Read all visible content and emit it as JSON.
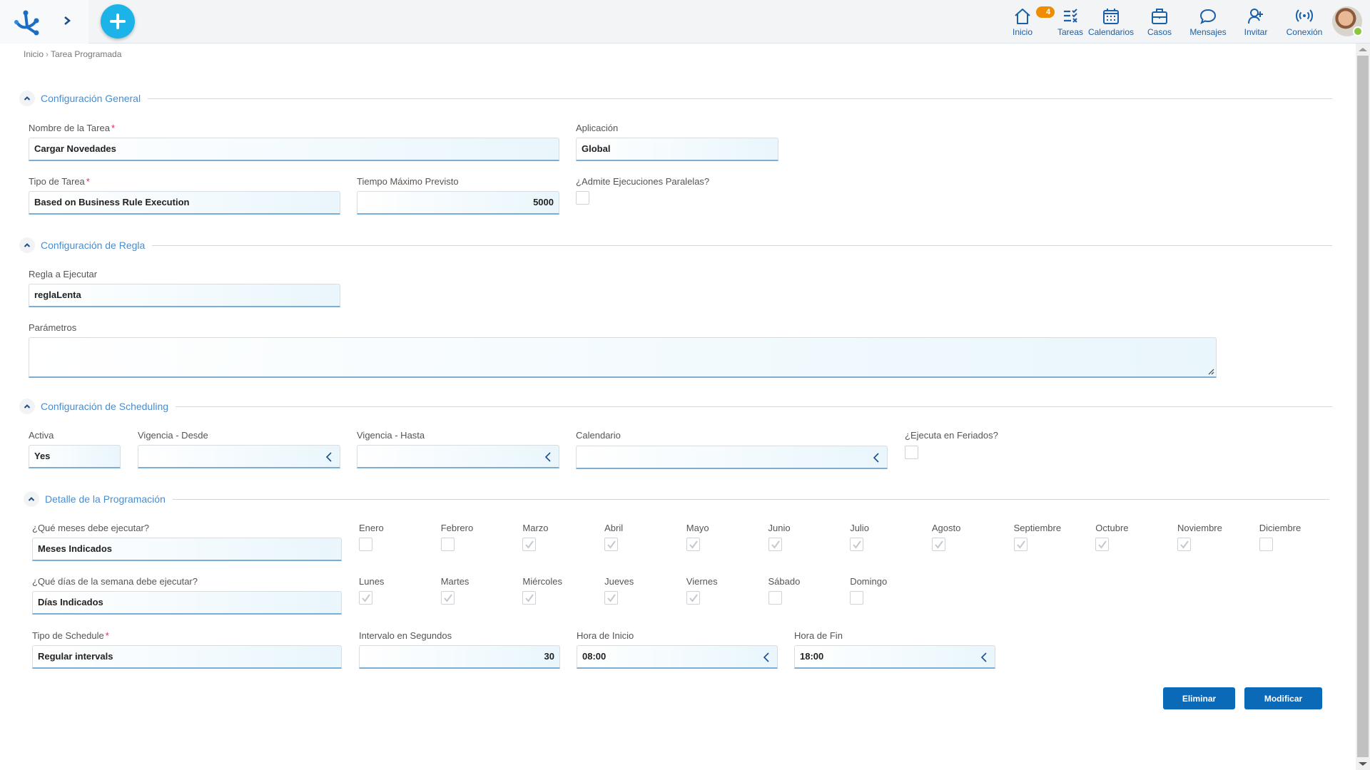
{
  "header": {
    "nav": [
      {
        "id": "inicio",
        "label": "Inicio",
        "icon": "home-icon"
      },
      {
        "id": "tareas",
        "label": "Tareas",
        "icon": "tasks-icon",
        "badge": "4"
      },
      {
        "id": "calendarios",
        "label": "Calendarios",
        "icon": "calendar-icon"
      },
      {
        "id": "casos",
        "label": "Casos",
        "icon": "briefcase-icon"
      },
      {
        "id": "mensajes",
        "label": "Mensajes",
        "icon": "chat-icon"
      },
      {
        "id": "invitar",
        "label": "Invitar",
        "icon": "add-user-icon"
      },
      {
        "id": "conexion",
        "label": "Conexión",
        "icon": "connection-icon"
      }
    ],
    "colors": {
      "accent": "#1bb3e8",
      "nav": "#1a5fa8",
      "badge": "#ef8c00",
      "status": "#8cc63f"
    }
  },
  "breadcrumb": {
    "items": [
      "Inicio",
      "Tarea Programada"
    ],
    "separator": "›"
  },
  "sections": {
    "general": {
      "title": "Configuración General",
      "nombre": {
        "label": "Nombre de la Tarea",
        "required": "*",
        "value": "Cargar Novedades"
      },
      "aplicacion": {
        "label": "Aplicación",
        "value": "Global"
      },
      "tipo": {
        "label": "Tipo de Tarea",
        "required": "*",
        "value": "Based on Business Rule Execution"
      },
      "tiempo": {
        "label": "Tiempo Máximo Previsto",
        "value": "5000"
      },
      "paralelas": {
        "label": "¿Admite Ejecuciones Paralelas?",
        "checked": false
      }
    },
    "regla": {
      "title": "Configuración de Regla",
      "regla": {
        "label": "Regla a Ejecutar",
        "value": "reglaLenta"
      },
      "parametros": {
        "label": "Parámetros",
        "value": ""
      }
    },
    "scheduling": {
      "title": "Configuración de Scheduling",
      "activa": {
        "label": "Activa",
        "value": "Yes"
      },
      "desde": {
        "label": "Vigencia - Desde",
        "value": ""
      },
      "hasta": {
        "label": "Vigencia - Hasta",
        "value": ""
      },
      "calendario": {
        "label": "Calendario",
        "value": ""
      },
      "feriados": {
        "label": "¿Ejecuta en Feriados?",
        "checked": false
      }
    },
    "detalle": {
      "title": "Detalle de la Programación",
      "meses": {
        "label": "¿Qué meses debe ejecutar?",
        "value": "Meses Indicados"
      },
      "months": [
        {
          "label": "Enero",
          "checked": false
        },
        {
          "label": "Febrero",
          "checked": false
        },
        {
          "label": "Marzo",
          "checked": true
        },
        {
          "label": "Abril",
          "checked": true
        },
        {
          "label": "Mayo",
          "checked": true
        },
        {
          "label": "Junio",
          "checked": true
        },
        {
          "label": "Julio",
          "checked": true
        },
        {
          "label": "Agosto",
          "checked": true
        },
        {
          "label": "Septiembre",
          "checked": true
        },
        {
          "label": "Octubre",
          "checked": true
        },
        {
          "label": "Noviembre",
          "checked": true
        },
        {
          "label": "Diciembre",
          "checked": false
        }
      ],
      "dias": {
        "label": "¿Qué días de la semana debe ejecutar?",
        "value": "Días Indicados"
      },
      "days": [
        {
          "label": "Lunes",
          "checked": true
        },
        {
          "label": "Martes",
          "checked": true
        },
        {
          "label": "Miércoles",
          "checked": true
        },
        {
          "label": "Jueves",
          "checked": true
        },
        {
          "label": "Viernes",
          "checked": true
        },
        {
          "label": "Sábado",
          "checked": false
        },
        {
          "label": "Domingo",
          "checked": false
        }
      ],
      "tipo_schedule": {
        "label": "Tipo de Schedule",
        "required": "*",
        "value": "Regular intervals"
      },
      "intervalo": {
        "label": "Intervalo en Segundos",
        "value": "30"
      },
      "hora_inicio": {
        "label": "Hora de Inicio",
        "value": "08:00"
      },
      "hora_fin": {
        "label": "Hora de Fin",
        "value": "18:00"
      }
    }
  },
  "actions": {
    "eliminar": "Eliminar",
    "modificar": "Modificar"
  }
}
